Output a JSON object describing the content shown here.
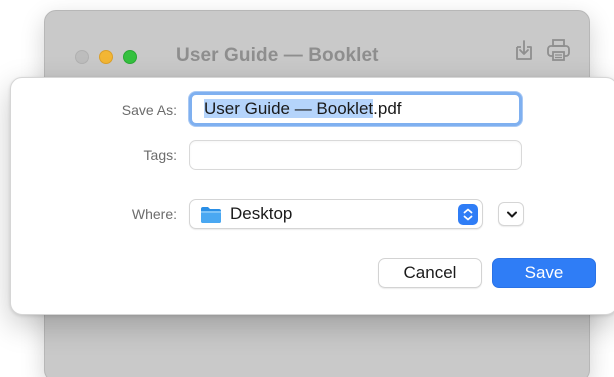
{
  "window": {
    "title": "User Guide — Booklet",
    "toolbar_icons": [
      "share-icon",
      "print-icon"
    ]
  },
  "dialog": {
    "save_as_label": "Save As:",
    "filename_selected": "User Guide — Booklet",
    "filename_extension": ".pdf",
    "tags_label": "Tags:",
    "tags_value": "",
    "where_label": "Where:",
    "where_value": "Desktop",
    "where_icon": "folder-icon",
    "cancel_label": "Cancel",
    "save_label": "Save"
  },
  "colors": {
    "accent": "#2f7df6",
    "selection": "#b5d4fb",
    "traffic_close": "#bdbdbd",
    "traffic_minimize": "#f3b634",
    "traffic_maximize": "#35c13f"
  }
}
